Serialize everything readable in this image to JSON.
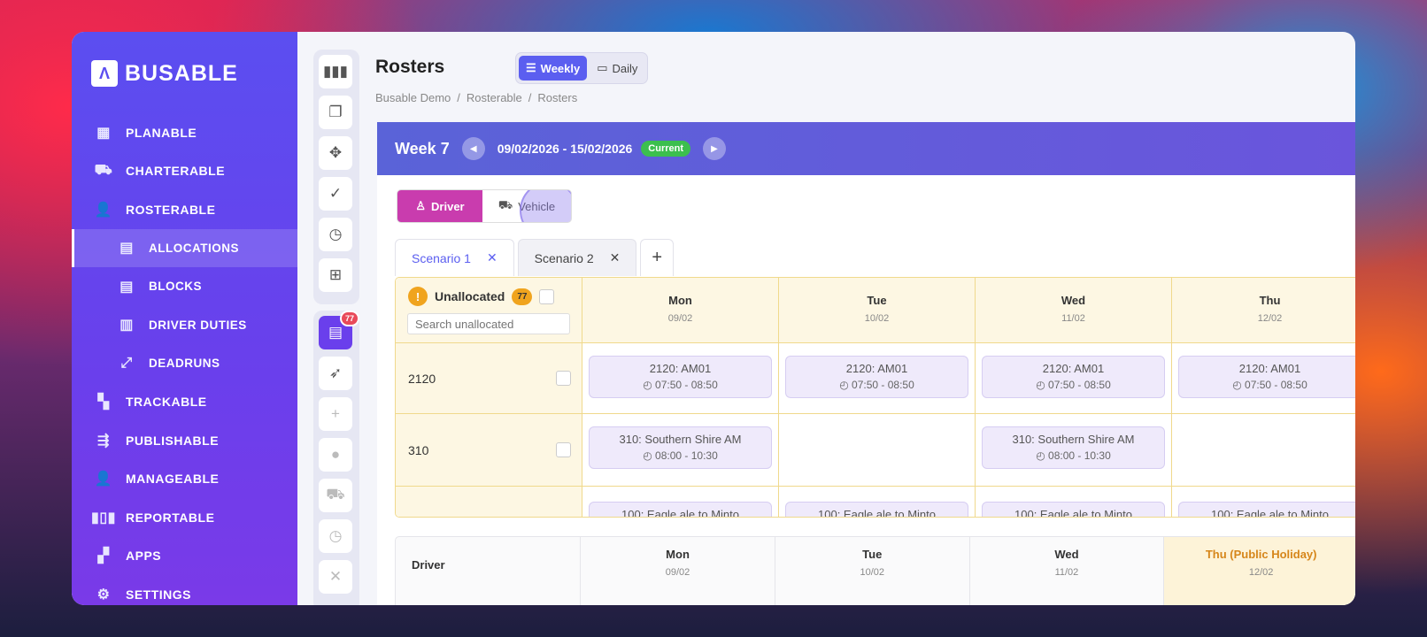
{
  "sidebar": {
    "logo": "BUSABLE",
    "items": [
      {
        "label": "PLANABLE",
        "icon": "grid-calendar-icon"
      },
      {
        "label": "CHARTERABLE",
        "icon": "bus-icon"
      },
      {
        "label": "ROSTERABLE",
        "icon": "user-lock-icon"
      },
      {
        "label": "ALLOCATIONS",
        "icon": "calendar-icon"
      },
      {
        "label": "BLOCKS",
        "icon": "calendar-icon"
      },
      {
        "label": "DRIVER DUTIES",
        "icon": "clipboard-icon"
      },
      {
        "label": "DEADRUNS",
        "icon": "route-icon"
      },
      {
        "label": "TRACKABLE",
        "icon": "map-icon"
      },
      {
        "label": "PUBLISHABLE",
        "icon": "publish-icon"
      },
      {
        "label": "MANAGEABLE",
        "icon": "user-lock-icon"
      },
      {
        "label": "REPORTABLE",
        "icon": "bar-chart-icon"
      },
      {
        "label": "APPS",
        "icon": "apps-icon"
      },
      {
        "label": "SETTINGS",
        "icon": "gear-icon"
      }
    ]
  },
  "toolbar": {
    "badge": "77"
  },
  "header": {
    "title": "Rosters",
    "weekly": "Weekly",
    "daily": "Daily",
    "crumbs": [
      "Busable Demo",
      "/",
      "Rosterable",
      "/",
      "Rosters"
    ]
  },
  "week": {
    "label": "Week 7",
    "range": "09/02/2026 - 15/02/2026",
    "current": "Current"
  },
  "mode": {
    "driver": "Driver",
    "vehicle": "Vehicle"
  },
  "tabs": [
    "Scenario 1",
    "Scenario 2"
  ],
  "grid": {
    "unallocated": "Unallocated",
    "count": "77",
    "search_placeholder": "Search unallocated",
    "days": [
      {
        "name": "Mon",
        "date": "09/02"
      },
      {
        "name": "Tue",
        "date": "10/02"
      },
      {
        "name": "Wed",
        "date": "11/02"
      },
      {
        "name": "Thu",
        "date": "12/02"
      }
    ],
    "rows": [
      {
        "label": "2120",
        "cards": [
          {
            "t": "2120: AM01",
            "tm": "07:50 - 08:50"
          },
          {
            "t": "2120: AM01",
            "tm": "07:50 - 08:50"
          },
          {
            "t": "2120: AM01",
            "tm": "07:50 - 08:50"
          },
          {
            "t": "2120: AM01",
            "tm": "07:50 - 08:50"
          }
        ]
      },
      {
        "label": "310",
        "cards": [
          {
            "t": "310: Southern Shire AM",
            "tm": "08:00 - 10:30"
          },
          null,
          {
            "t": "310: Southern Shire AM",
            "tm": "08:00 - 10:30"
          },
          null
        ]
      },
      {
        "label": "",
        "cards": [
          {
            "t": "100: Eagle ale to Minto",
            "tm": ""
          },
          {
            "t": "100: Eagle ale to Minto",
            "tm": ""
          },
          {
            "t": "100: Eagle ale to Minto",
            "tm": ""
          },
          {
            "t": "100: Eagle ale to Minto",
            "tm": ""
          }
        ]
      }
    ]
  },
  "drivers": {
    "header": "Driver",
    "days": [
      {
        "name": "Mon",
        "date": "09/02"
      },
      {
        "name": "Tue",
        "date": "10/02"
      },
      {
        "name": "Wed",
        "date": "11/02"
      },
      {
        "name": "Thu (Public Holiday)",
        "date": "12/02"
      }
    ]
  }
}
